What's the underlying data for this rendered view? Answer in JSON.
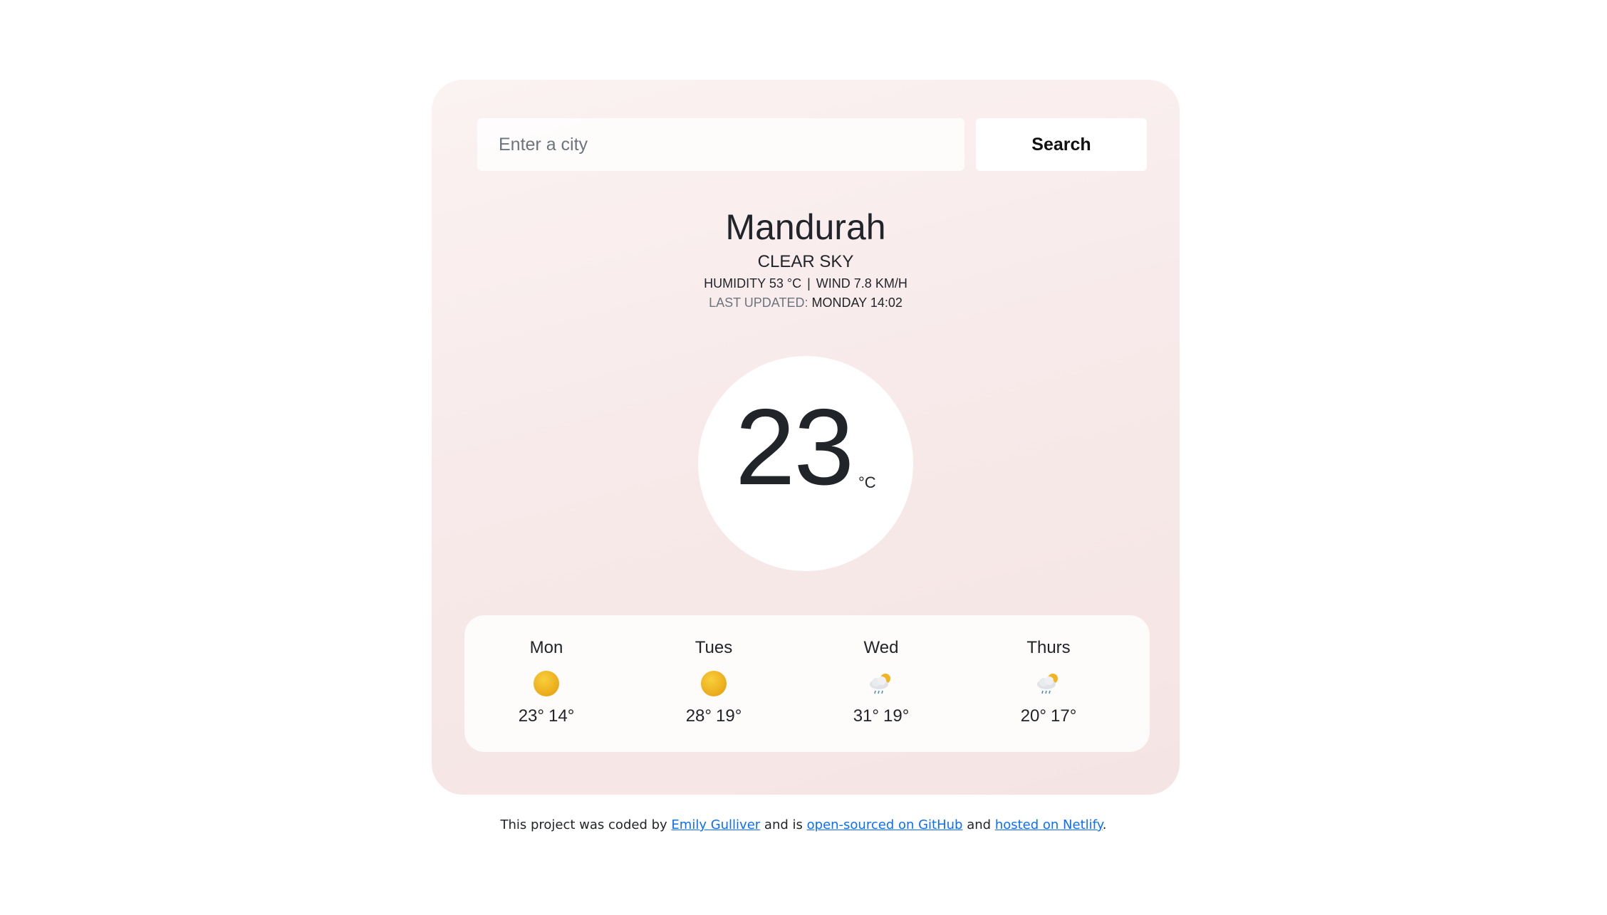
{
  "search": {
    "placeholder": "Enter a city",
    "button_label": "Search"
  },
  "current": {
    "city": "Mandurah",
    "description": "CLEAR SKY",
    "humidity_label": "HUMIDITY",
    "humidity_value": "53 °C",
    "wind_label": "WIND",
    "wind_value": "7.8 KM/H",
    "separator": "|",
    "last_updated_label": "LAST UPDATED:",
    "last_updated_value": "MONDAY 14:02",
    "temperature": "23",
    "unit": "°C"
  },
  "forecast": [
    {
      "day": "Mon",
      "icon": "sun-icon",
      "max": "23°",
      "min": "14°"
    },
    {
      "day": "Tues",
      "icon": "sun-icon",
      "max": "28°",
      "min": "19°"
    },
    {
      "day": "Wed",
      "icon": "rain-cloud-sun-icon",
      "max": "31°",
      "min": "19°"
    },
    {
      "day": "Thurs",
      "icon": "rain-cloud-sun-icon",
      "max": "20°",
      "min": "17°"
    }
  ],
  "footer": {
    "text_1": "This project was coded by",
    "author_link": "Emily Gulliver",
    "text_2": "and is",
    "github_link": "open-sourced on GitHub",
    "text_3": "and",
    "netlify_link": "hosted on Netlify",
    "text_4": "."
  },
  "colors": {
    "card_background": "#f8eaea",
    "link": "#0d6efd",
    "sun": "#f0b521"
  }
}
